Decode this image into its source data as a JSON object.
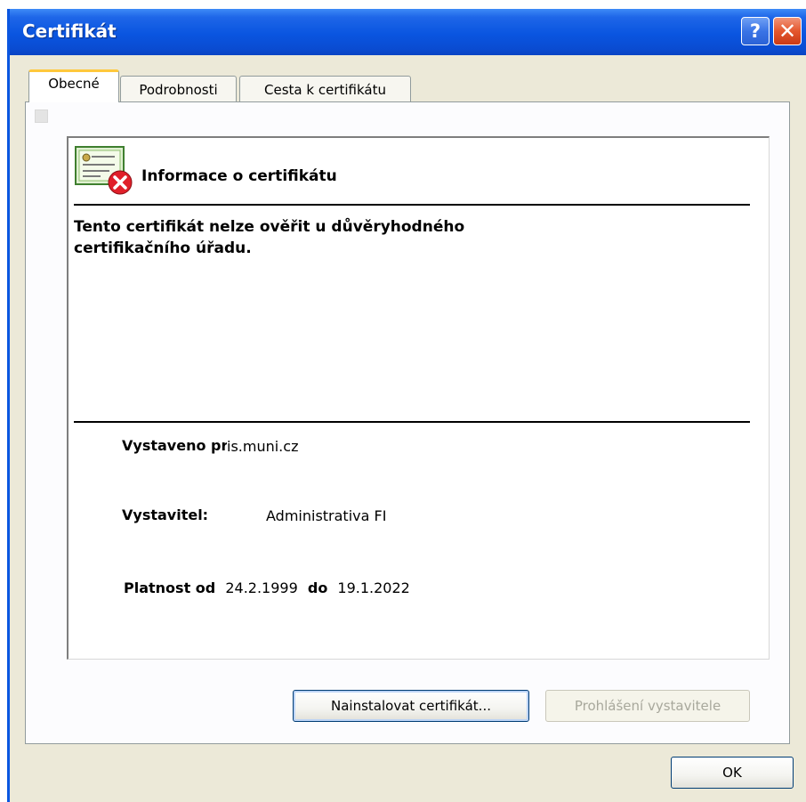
{
  "window": {
    "title": "Certifikát",
    "help_glyph": "?",
    "close_glyph": "✕"
  },
  "tabs": [
    {
      "label": "Obecné",
      "active": true
    },
    {
      "label": "Podrobnosti",
      "active": false
    },
    {
      "label": "Cesta k certifikátu",
      "active": false
    }
  ],
  "info": {
    "heading": "Informace o certifikátu",
    "icon": "certificate-error-icon",
    "warning_line1": "Tento certifikát nelze ověřit u důvěryhodného",
    "warning_line2": "certifikačního úřadu.",
    "issued_to_label": "Vystaveno pro:",
    "issued_to_value": "is.muni.cz",
    "issuer_label": "Vystavitel:",
    "issuer_value": "Administrativa FI",
    "valid_from_label": "Platnost od",
    "valid_from_value": "24.2.1999",
    "valid_to_label": "do",
    "valid_to_value": "19.1.2022"
  },
  "buttons": {
    "install": "Nainstalovat certifikát...",
    "issuer_statement": "Prohlášení vystavitele",
    "ok": "OK"
  },
  "colors": {
    "titlebar": "#0A55E0",
    "dialog_bg": "#ECE9D8",
    "active_tab_accent": "#FFC83C"
  }
}
